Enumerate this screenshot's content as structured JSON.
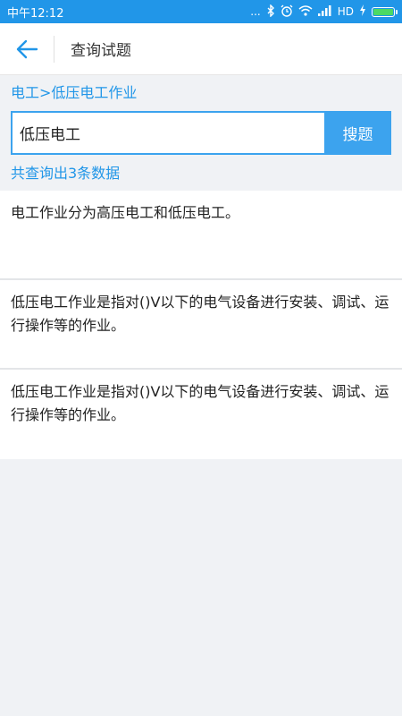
{
  "status_bar": {
    "time": "中午12:12",
    "dots": "...",
    "network": "HD",
    "icons": [
      "bluetooth-icon",
      "alarm-icon",
      "wifi-icon",
      "signal-icon",
      "charging-icon",
      "battery-icon"
    ],
    "color": "#2196e8"
  },
  "header": {
    "title": "查询试题"
  },
  "breadcrumb": "电工>低压电工作业",
  "search": {
    "value": "低压电工",
    "button_label": "搜题"
  },
  "result_count": "共查询出3条数据",
  "results": [
    {
      "text": "电工作业分为高压电工和低压电工。"
    },
    {
      "text": "低压电工作业是指对()V以下的电气设备进行安装、调试、运行操作等的作业。"
    },
    {
      "text": "低压电工作业是指对()V以下的电气设备进行安装、调试、运行操作等的作业。"
    }
  ],
  "colors": {
    "accent": "#2196e8",
    "button": "#3ca3ee",
    "background": "#f0f2f5"
  }
}
